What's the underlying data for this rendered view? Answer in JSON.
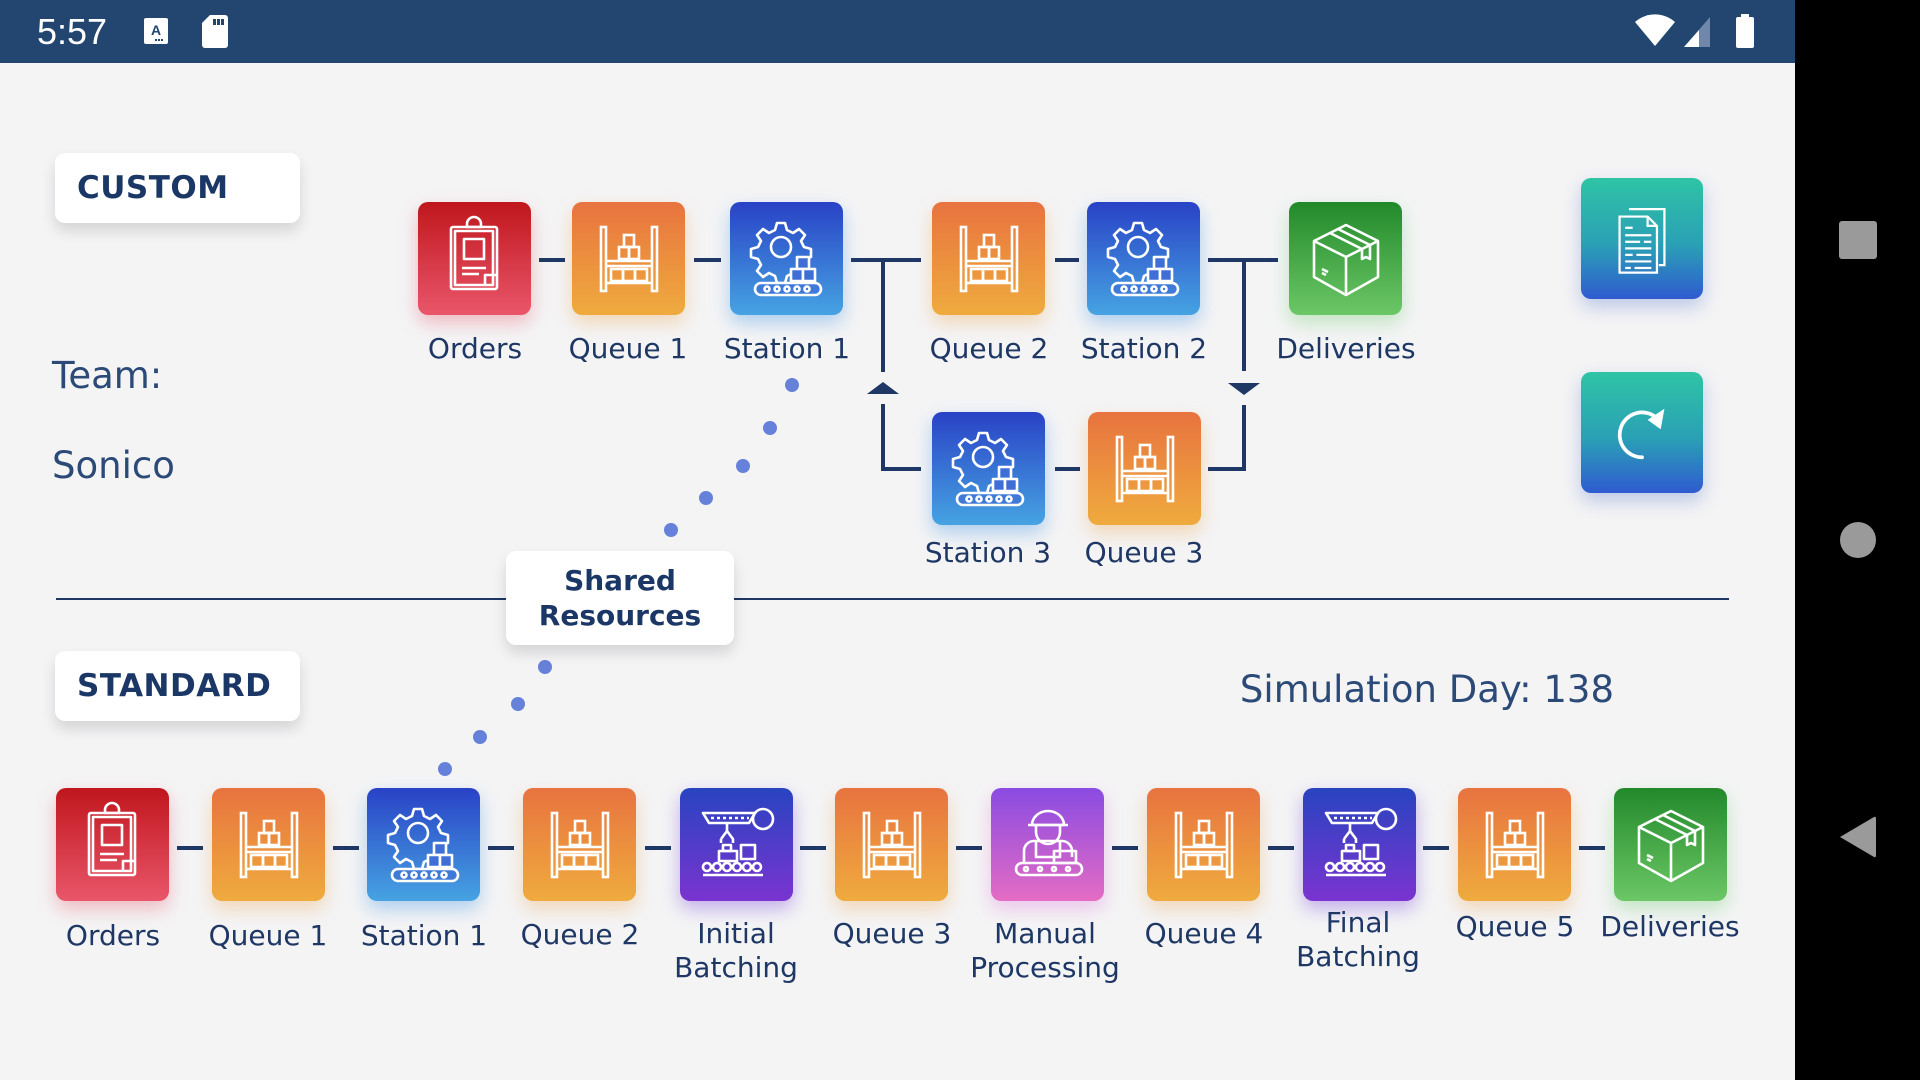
{
  "status_bar": {
    "time": "5:57",
    "icons": [
      "keyboard-a-icon",
      "sd-card-icon",
      "wifi-icon",
      "cell-signal-icon",
      "battery-icon"
    ],
    "color": "#22466f"
  },
  "custom": {
    "mode_label": "CUSTOM",
    "team_label": "Team:",
    "team_name": "Sonico",
    "nodes": [
      {
        "label": "Orders",
        "icon": "clipboard-icon",
        "color": "red"
      },
      {
        "label": "Queue 1",
        "icon": "warehouse-shelf-icon",
        "color": "orange"
      },
      {
        "label": "Station 1",
        "icon": "gear-conveyor-icon",
        "color": "blue"
      },
      {
        "label": "Queue 2",
        "icon": "warehouse-shelf-icon",
        "color": "orange"
      },
      {
        "label": "Station 2",
        "icon": "gear-conveyor-icon",
        "color": "blue"
      },
      {
        "label": "Deliveries",
        "icon": "package-box-icon",
        "color": "green"
      },
      {
        "label": "Station 3",
        "icon": "gear-conveyor-icon",
        "color": "blue"
      },
      {
        "label": "Queue 3",
        "icon": "warehouse-shelf-icon",
        "color": "orange"
      }
    ]
  },
  "shared_resources": {
    "label_line1": "Shared",
    "label_line2": "Resources"
  },
  "standard": {
    "mode_label": "STANDARD",
    "simulation_day_label": "Simulation Day: 138",
    "nodes": [
      {
        "label": "Orders",
        "icon": "clipboard-icon",
        "color": "red"
      },
      {
        "label": "Queue 1",
        "icon": "warehouse-shelf-icon",
        "color": "orange"
      },
      {
        "label": "Station 1",
        "icon": "gear-conveyor-icon",
        "color": "blue"
      },
      {
        "label": "Queue 2",
        "icon": "warehouse-shelf-icon",
        "color": "orange"
      },
      {
        "label": "Initial Batching",
        "line1": "Initial",
        "line2": "Batching",
        "icon": "robot-arm-conveyor-icon",
        "color": "indigo"
      },
      {
        "label": "Queue 3",
        "icon": "warehouse-shelf-icon",
        "color": "orange"
      },
      {
        "label": "Manual Processing",
        "line1": "Manual",
        "line2": "Processing",
        "icon": "worker-conveyor-icon",
        "color": "purple"
      },
      {
        "label": "Queue 4",
        "icon": "warehouse-shelf-icon",
        "color": "orange"
      },
      {
        "label": "Final Batching",
        "line1": "Final",
        "line2": "Batching",
        "icon": "robot-arm-conveyor-icon",
        "color": "indigo"
      },
      {
        "label": "Queue 5",
        "icon": "warehouse-shelf-icon",
        "color": "orange"
      },
      {
        "label": "Deliveries",
        "icon": "package-box-icon",
        "color": "green"
      }
    ]
  },
  "side_buttons": [
    {
      "name": "documents",
      "icon": "documents-icon"
    },
    {
      "name": "refresh",
      "icon": "refresh-icon"
    }
  ],
  "nav_bar": {
    "buttons": [
      "recents",
      "home",
      "back"
    ]
  }
}
